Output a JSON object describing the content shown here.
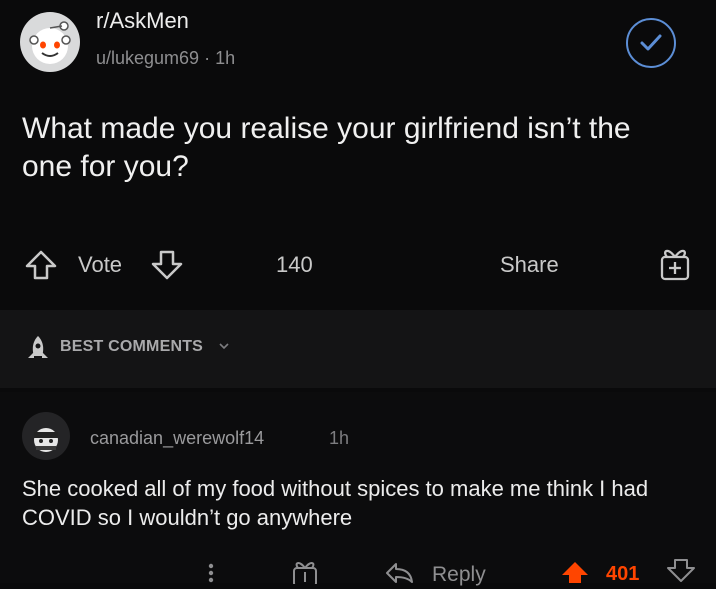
{
  "post": {
    "subreddit": "r/AskMen",
    "author": "u/lukegum69",
    "age": "1h",
    "title": "What made you realise your girlfriend isn’t the one for you?",
    "vote_label": "Vote",
    "comment_count": "140",
    "share_label": "Share"
  },
  "comments_section": {
    "sort_label": "BEST COMMENTS"
  },
  "comment": {
    "username": "canadian_werewolf14",
    "age": "1h",
    "body": "She cooked all of my food without spices to make me think I had COVID so I wouldn’t go anywhere",
    "reply_label": "Reply",
    "score": "401"
  },
  "colors": {
    "background": "#0a0a0b",
    "accent_blue": "#5c8ed6",
    "upvote_orange": "#ff4500"
  },
  "icons": [
    "snoo-avatar",
    "check-circle-icon",
    "upvote-icon",
    "downvote-icon",
    "award-icon",
    "rocket-icon",
    "chevron-down-icon",
    "more-icon",
    "reply-icon"
  ]
}
